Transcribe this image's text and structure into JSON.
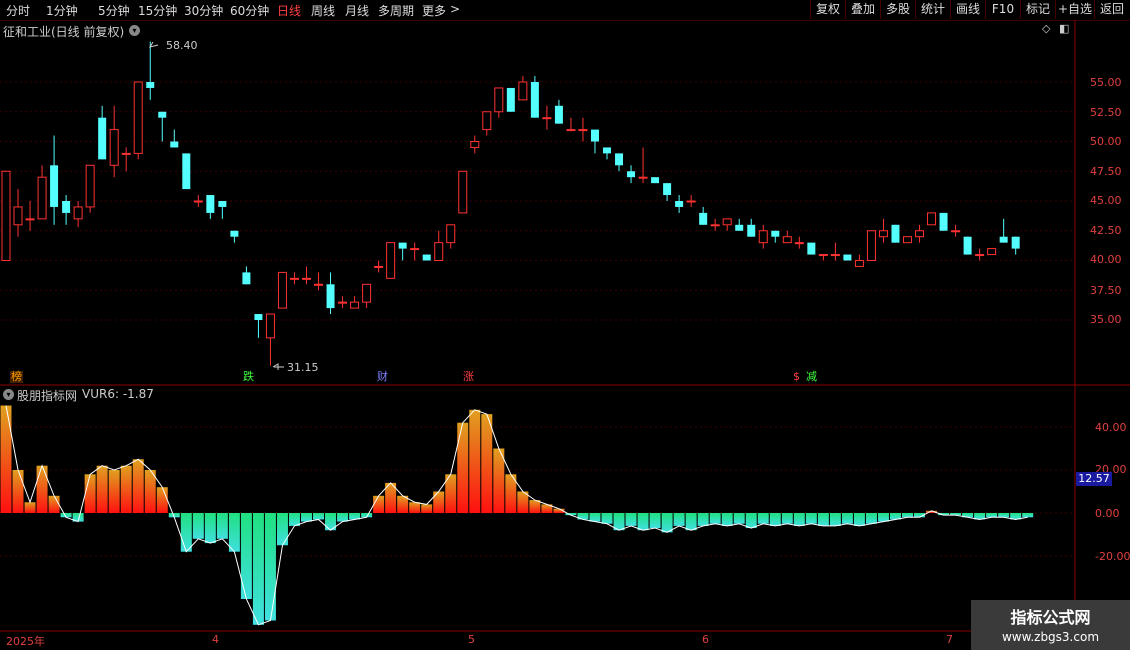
{
  "toolbar": {
    "periods": [
      "分时",
      "1分钟",
      "5分钟",
      "15分钟",
      "30分钟",
      "60分钟",
      "日线",
      "周线",
      "月线",
      "多周期",
      "更多"
    ],
    "active_period": "日线",
    "more_arrow": ">",
    "right_buttons": [
      "复权",
      "叠加",
      "多股",
      "统计",
      "画线",
      "F10",
      "标记",
      "+自选",
      "返回"
    ]
  },
  "main_chart": {
    "title": "征和工业(日线 前复权)",
    "high_label": "58.40",
    "low_label": "31.15",
    "price_ticks": [
      "55.00",
      "52.50",
      "50.00",
      "47.50",
      "45.00",
      "42.50",
      "40.00",
      "37.50",
      "35.00"
    ],
    "events": [
      {
        "label": "榜",
        "color": "#ffa000"
      },
      {
        "label": "跌",
        "color": "#40ff40"
      },
      {
        "label": "财",
        "color": "#8080ff"
      },
      {
        "label": "涨",
        "color": "#ff4040"
      },
      {
        "label": "$",
        "color": "#ff4040"
      },
      {
        "label": "减",
        "color": "#40ff40"
      }
    ]
  },
  "indicator": {
    "title": "股朋指标网",
    "value_label": "VUR6: -1.87",
    "ticks": [
      "40.00",
      "20.00",
      "0.00",
      "-20.00"
    ],
    "current_value": "12.57"
  },
  "x_axis": {
    "labels": [
      "2025年",
      "4",
      "5",
      "6",
      "7"
    ]
  },
  "watermark": {
    "line1": "指标公式网",
    "line2": "www.zbgs3.com"
  },
  "chart_data": {
    "type": "candlestick",
    "price_ylim": [
      31.15,
      58.4
    ],
    "ohlc": [
      [
        40,
        47.5,
        40,
        47.5
      ],
      [
        43,
        46,
        42,
        44.5
      ],
      [
        43.5,
        45,
        42.5,
        43.5
      ],
      [
        43.5,
        48,
        43.5,
        47
      ],
      [
        48,
        50.5,
        43,
        44.5
      ],
      [
        45,
        45.5,
        43,
        44
      ],
      [
        43.5,
        45,
        42.8,
        44.5
      ],
      [
        44.5,
        48,
        44,
        48
      ],
      [
        52,
        53,
        48.5,
        48.5
      ],
      [
        48,
        53,
        47,
        51
      ],
      [
        49,
        49.5,
        47.5,
        49
      ],
      [
        49,
        55,
        48.5,
        55
      ],
      [
        55,
        58.4,
        53.5,
        54.5
      ],
      [
        52.5,
        52.5,
        50,
        52
      ],
      [
        50,
        51,
        49.5,
        49.5
      ],
      [
        49,
        49,
        46,
        46
      ],
      [
        45,
        45.5,
        44.5,
        45
      ],
      [
        45.5,
        45.5,
        43.5,
        44
      ],
      [
        45,
        45,
        43.5,
        44.5
      ],
      [
        42.5,
        42.5,
        41.5,
        42
      ],
      [
        39,
        39.5,
        38,
        38
      ],
      [
        35.5,
        35.5,
        33.5,
        35
      ],
      [
        33.5,
        35,
        31.15,
        35.5
      ],
      [
        36,
        39,
        36,
        39
      ],
      [
        38.5,
        39,
        38,
        38.5
      ],
      [
        38.5,
        39.5,
        38,
        38.5
      ],
      [
        38,
        39,
        37.5,
        38
      ],
      [
        38,
        39,
        35.5,
        36
      ],
      [
        36.5,
        37,
        36,
        36.5
      ],
      [
        36,
        37,
        36,
        36.5
      ],
      [
        36.5,
        38,
        36,
        38
      ],
      [
        39.5,
        40,
        39,
        39.5
      ],
      [
        38.5,
        41.5,
        38.5,
        41.5
      ],
      [
        41.5,
        41.5,
        40,
        41
      ],
      [
        41,
        41.5,
        40,
        41
      ],
      [
        40.5,
        40.5,
        40,
        40
      ],
      [
        40,
        42.5,
        40,
        41.5
      ],
      [
        41.5,
        43,
        41,
        43
      ],
      [
        44,
        47.5,
        44,
        47.5
      ],
      [
        49.5,
        50.5,
        49,
        50
      ],
      [
        51,
        52.5,
        50.5,
        52.5
      ],
      [
        52.5,
        54.5,
        52,
        54.5
      ],
      [
        54.5,
        54.5,
        52.5,
        52.5
      ],
      [
        53.5,
        55.5,
        53.5,
        55
      ],
      [
        55,
        55.5,
        52,
        52
      ],
      [
        52,
        53,
        51,
        52
      ],
      [
        53,
        53.5,
        51.5,
        51.5
      ],
      [
        51,
        52,
        51,
        51
      ],
      [
        51,
        52,
        50,
        51
      ],
      [
        51,
        51,
        49,
        50
      ],
      [
        49.5,
        49.5,
        48.5,
        49
      ],
      [
        49,
        49,
        47.5,
        48
      ],
      [
        47.5,
        48,
        46.5,
        47
      ],
      [
        47,
        49.5,
        46.5,
        47
      ],
      [
        47,
        47,
        46.5,
        46.5
      ],
      [
        46.5,
        46.5,
        45,
        45.5
      ],
      [
        45,
        45.5,
        44,
        44.5
      ],
      [
        45,
        45.5,
        44.5,
        45
      ],
      [
        44,
        44.5,
        43,
        43
      ],
      [
        43,
        43.5,
        42.5,
        43
      ],
      [
        43,
        43.5,
        42.5,
        43.5
      ],
      [
        43,
        43.5,
        42.5,
        42.5
      ],
      [
        43,
        43.5,
        42,
        42
      ],
      [
        41.5,
        43,
        41,
        42.5
      ],
      [
        42.5,
        42.5,
        41.5,
        42
      ],
      [
        41.5,
        42.5,
        41.5,
        42
      ],
      [
        41.5,
        42,
        41,
        41.5
      ],
      [
        41.5,
        41.5,
        40.5,
        40.5
      ],
      [
        40.5,
        40.5,
        40,
        40.5
      ],
      [
        40.5,
        41.5,
        40,
        40.5
      ],
      [
        40.5,
        40.5,
        40,
        40
      ],
      [
        39.5,
        40.5,
        39.5,
        40
      ],
      [
        40,
        42.5,
        40,
        42.5
      ],
      [
        42,
        43.5,
        41.5,
        42.5
      ],
      [
        43,
        43,
        41.5,
        41.5
      ],
      [
        41.5,
        42,
        41.5,
        42
      ],
      [
        42,
        43,
        41.5,
        42.5
      ],
      [
        43,
        44,
        43,
        44
      ],
      [
        44,
        44,
        42.5,
        42.5
      ],
      [
        42.5,
        43,
        42,
        42.5
      ],
      [
        42,
        42,
        40.5,
        40.5
      ],
      [
        40.5,
        41,
        40,
        40.5
      ],
      [
        40.5,
        41,
        40.5,
        41
      ],
      [
        42,
        43.5,
        41.5,
        41.5
      ],
      [
        42,
        42,
        40.5,
        41
      ]
    ],
    "indicator_values": [
      50,
      20,
      5,
      22,
      8,
      -2,
      -4,
      18,
      22,
      20,
      22,
      25,
      20,
      12,
      -2,
      -18,
      -12,
      -14,
      -12,
      -18,
      -40,
      -52,
      -50,
      -15,
      -6,
      -4,
      -3,
      -8,
      -4,
      -3,
      -2,
      8,
      14,
      8,
      5,
      4,
      10,
      18,
      42,
      48,
      46,
      30,
      18,
      10,
      6,
      4,
      2,
      -1,
      -3,
      -4,
      -5,
      -8,
      -6,
      -8,
      -7,
      -9,
      -6,
      -8,
      -6,
      -5,
      -6,
      -5,
      -7,
      -5,
      -6,
      -5,
      -6,
      -5,
      -6,
      -6,
      -5,
      -6,
      -5,
      -4,
      -3,
      -2,
      -2,
      1,
      -1,
      -1,
      -2,
      -3,
      -2,
      -2,
      -3,
      -2
    ]
  },
  "colors": {
    "up": "#ff3232",
    "down": "#54ffff",
    "grid": "#3a0000",
    "axis": "#e04040",
    "ind_pos_top": "#e0a020",
    "ind_pos_bottom": "#ff1010",
    "ind_neg_top": "#20e080",
    "ind_neg_bottom": "#40e0e0"
  }
}
